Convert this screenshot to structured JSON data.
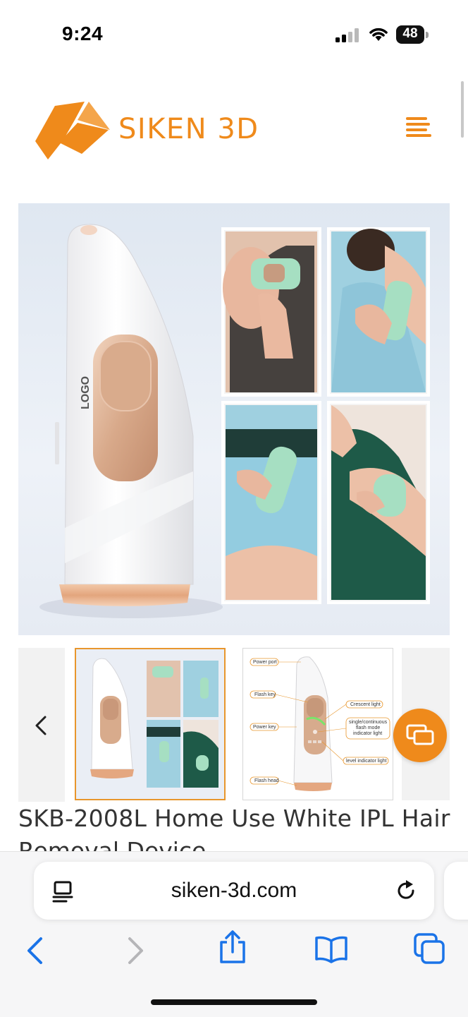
{
  "status_bar": {
    "time": "9:24",
    "battery": "48"
  },
  "site": {
    "brand": "SIKEN 3D",
    "brand_color": "#ef8a1b",
    "menu_icon": "hamburger-menu-icon"
  },
  "hero": {
    "logo_on_device": "LOGO"
  },
  "thumbnail2_callouts": {
    "power_port": "Power port",
    "flash_key": "Flash key",
    "power_key": "Power key",
    "flash_head": "Flash head",
    "crescent_light": "Crescent light",
    "single_continuous": "single/continuous",
    "flash_mode": "flash mode",
    "indicator_light": "indicator light",
    "level_indicator": "level indicator light"
  },
  "product": {
    "title_line1": "SKB-2008L Home Use White IPL Hair",
    "title_line2": "Removal Device"
  },
  "browser": {
    "url": "siken-3d.com"
  }
}
